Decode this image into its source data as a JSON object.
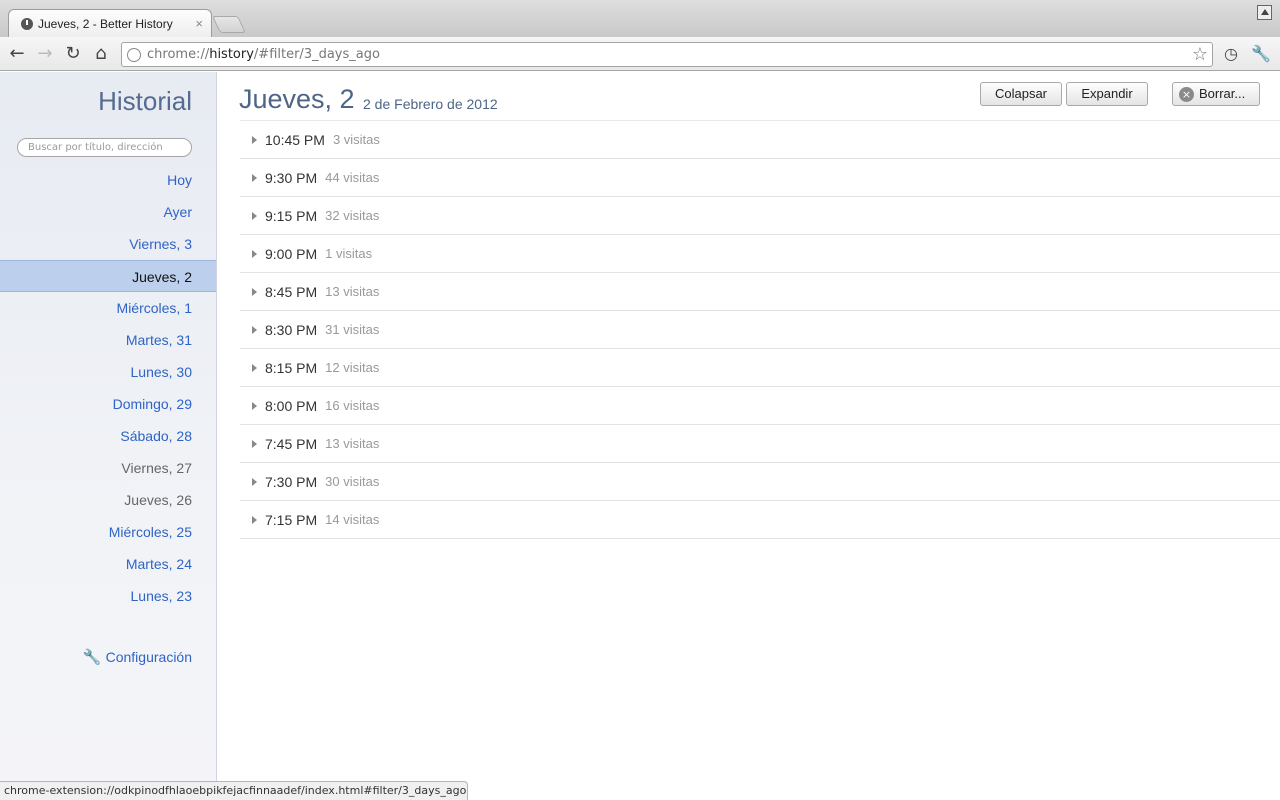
{
  "browser": {
    "tab_title": "Jueves, 2 - Better History",
    "tab_close": "×",
    "url_prefix": "chrome://",
    "url_host": "history",
    "url_rest": "/#filter/3_days_ago",
    "status_url": "chrome-extension://odkpinodfhlaoebpikfejacfinnaadef/index.html#filter/3_days_ago"
  },
  "sidebar": {
    "title": "Historial",
    "search_placeholder": "Buscar por título, dirección",
    "days": [
      {
        "label": "Hoy",
        "state": "link"
      },
      {
        "label": "Ayer",
        "state": "link"
      },
      {
        "label": "Viernes, 3",
        "state": "link"
      },
      {
        "label": "Jueves, 2",
        "state": "selected"
      },
      {
        "label": "Miércoles, 1",
        "state": "link"
      },
      {
        "label": "Martes, 31",
        "state": "link"
      },
      {
        "label": "Lunes, 30",
        "state": "link"
      },
      {
        "label": "Domingo, 29",
        "state": "link"
      },
      {
        "label": "Sábado, 28",
        "state": "link"
      },
      {
        "label": "Viernes, 27",
        "state": "grey"
      },
      {
        "label": "Jueves, 26",
        "state": "grey"
      },
      {
        "label": "Miércoles, 25",
        "state": "link"
      },
      {
        "label": "Martes, 24",
        "state": "link"
      },
      {
        "label": "Lunes, 23",
        "state": "link"
      }
    ],
    "settings_label": "Configuración"
  },
  "main": {
    "title": "Jueves, 2",
    "subtitle": "2 de Febrero de 2012",
    "collapse_label": "Colapsar",
    "expand_label": "Expandir",
    "delete_label": "Borrar...",
    "intervals": [
      {
        "time": "10:45 PM",
        "visits": "3 visitas"
      },
      {
        "time": "9:30 PM",
        "visits": "44 visitas"
      },
      {
        "time": "9:15 PM",
        "visits": "32 visitas"
      },
      {
        "time": "9:00 PM",
        "visits": "1 visitas"
      },
      {
        "time": "8:45 PM",
        "visits": "13 visitas"
      },
      {
        "time": "8:30 PM",
        "visits": "31 visitas"
      },
      {
        "time": "8:15 PM",
        "visits": "12 visitas"
      },
      {
        "time": "8:00 PM",
        "visits": "16 visitas"
      },
      {
        "time": "7:45 PM",
        "visits": "13 visitas"
      },
      {
        "time": "7:30 PM",
        "visits": "30 visitas"
      },
      {
        "time": "7:15 PM",
        "visits": "14 visitas"
      }
    ]
  },
  "colors": {
    "link": "#2f64c6",
    "title": "#4e6587",
    "selected_bg": "#bcd0ed"
  }
}
